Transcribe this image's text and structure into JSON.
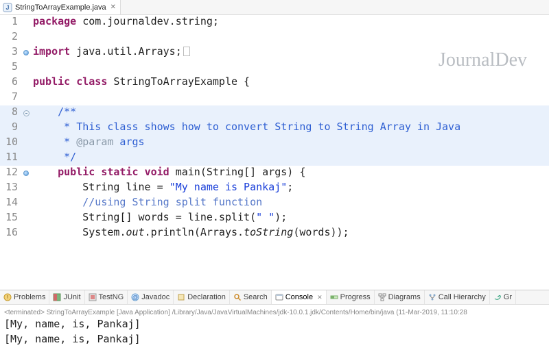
{
  "tab": {
    "file_name": "StringToArrayExample.java"
  },
  "watermark": "JournalDev",
  "code": {
    "lines": [
      {
        "n": 1,
        "segs": [
          {
            "c": "tok-key",
            "t": "package"
          },
          {
            "c": "",
            "t": " "
          },
          {
            "c": "tok-ident",
            "t": "com.journaldev.string"
          },
          {
            "c": "",
            "t": ";"
          }
        ]
      },
      {
        "n": 2,
        "segs": []
      },
      {
        "n": 3,
        "marker": "dot",
        "fold": true,
        "segs": [
          {
            "c": "tok-key",
            "t": "import"
          },
          {
            "c": "",
            "t": " "
          },
          {
            "c": "tok-ident",
            "t": "java.util.Arrays"
          },
          {
            "c": "",
            "t": ";"
          },
          {
            "c": "__box__",
            "t": ""
          }
        ]
      },
      {
        "n": 5,
        "segs": []
      },
      {
        "n": 6,
        "segs": [
          {
            "c": "tok-key",
            "t": "public"
          },
          {
            "c": "",
            "t": " "
          },
          {
            "c": "tok-key",
            "t": "class"
          },
          {
            "c": "",
            "t": " "
          },
          {
            "c": "tok-type",
            "t": "StringToArrayExample"
          },
          {
            "c": "",
            "t": " {"
          }
        ]
      },
      {
        "n": 7,
        "segs": []
      },
      {
        "n": 8,
        "hl": true,
        "fold": true,
        "segs": [
          {
            "c": "tok-doc",
            "t": "    /**"
          }
        ]
      },
      {
        "n": 9,
        "hl": true,
        "segs": [
          {
            "c": "tok-doc",
            "t": "     * This class shows how to convert String to String Array in Java"
          }
        ]
      },
      {
        "n": 10,
        "hl": true,
        "segs": [
          {
            "c": "tok-doc",
            "t": "     * "
          },
          {
            "c": "tok-doctag",
            "t": "@param"
          },
          {
            "c": "tok-doc",
            "t": " args"
          }
        ]
      },
      {
        "n": 11,
        "hl": true,
        "segs": [
          {
            "c": "tok-doc",
            "t": "     */"
          }
        ]
      },
      {
        "n": 12,
        "fold": true,
        "marker": "dot",
        "segs": [
          {
            "c": "",
            "t": "    "
          },
          {
            "c": "tok-key",
            "t": "public"
          },
          {
            "c": "",
            "t": " "
          },
          {
            "c": "tok-key",
            "t": "static"
          },
          {
            "c": "",
            "t": " "
          },
          {
            "c": "tok-key",
            "t": "void"
          },
          {
            "c": "",
            "t": " "
          },
          {
            "c": "tok-ident",
            "t": "main"
          },
          {
            "c": "",
            "t": "("
          },
          {
            "c": "tok-type",
            "t": "String"
          },
          {
            "c": "",
            "t": "[] "
          },
          {
            "c": "tok-ident",
            "t": "args"
          },
          {
            "c": "",
            "t": ") {"
          }
        ]
      },
      {
        "n": 13,
        "segs": [
          {
            "c": "",
            "t": "        "
          },
          {
            "c": "tok-type",
            "t": "String"
          },
          {
            "c": "",
            "t": " "
          },
          {
            "c": "tok-ident",
            "t": "line"
          },
          {
            "c": "",
            "t": " = "
          },
          {
            "c": "tok-str",
            "t": "\"My name is Pankaj\""
          },
          {
            "c": "",
            "t": ";"
          }
        ]
      },
      {
        "n": 14,
        "segs": [
          {
            "c": "",
            "t": "        "
          },
          {
            "c": "tok-comment",
            "t": "//using String split function"
          }
        ]
      },
      {
        "n": 15,
        "segs": [
          {
            "c": "",
            "t": "        "
          },
          {
            "c": "tok-type",
            "t": "String"
          },
          {
            "c": "",
            "t": "[] "
          },
          {
            "c": "tok-ident",
            "t": "words"
          },
          {
            "c": "",
            "t": " = "
          },
          {
            "c": "tok-ident",
            "t": "line"
          },
          {
            "c": "",
            "t": "."
          },
          {
            "c": "tok-ident",
            "t": "split"
          },
          {
            "c": "",
            "t": "("
          },
          {
            "c": "tok-str",
            "t": "\" \""
          },
          {
            "c": "",
            "t": ");"
          }
        ]
      },
      {
        "n": 16,
        "segs": [
          {
            "c": "",
            "t": "        "
          },
          {
            "c": "tok-type",
            "t": "System"
          },
          {
            "c": "",
            "t": "."
          },
          {
            "c": "tok-static",
            "t": "out"
          },
          {
            "c": "",
            "t": "."
          },
          {
            "c": "tok-ident",
            "t": "println"
          },
          {
            "c": "",
            "t": "("
          },
          {
            "c": "tok-type",
            "t": "Arrays"
          },
          {
            "c": "",
            "t": "."
          },
          {
            "c": "tok-func",
            "t": "toString"
          },
          {
            "c": "",
            "t": "("
          },
          {
            "c": "tok-ident",
            "t": "words"
          },
          {
            "c": "",
            "t": "));"
          }
        ]
      }
    ]
  },
  "panel_tabs": [
    {
      "id": "problems",
      "label": "Problems",
      "icon": "problems"
    },
    {
      "id": "junit",
      "label": "JUnit",
      "icon": "junit"
    },
    {
      "id": "testng",
      "label": "TestNG",
      "icon": "testng"
    },
    {
      "id": "javadoc",
      "label": "Javadoc",
      "icon": "javadoc"
    },
    {
      "id": "declaration",
      "label": "Declaration",
      "icon": "declaration"
    },
    {
      "id": "search",
      "label": "Search",
      "icon": "search"
    },
    {
      "id": "console",
      "label": "Console",
      "icon": "console",
      "active": true,
      "closable": true
    },
    {
      "id": "progress",
      "label": "Progress",
      "icon": "progress"
    },
    {
      "id": "diagrams",
      "label": "Diagrams",
      "icon": "diagrams"
    },
    {
      "id": "callhierarchy",
      "label": "Call Hierarchy",
      "icon": "callhierarchy"
    },
    {
      "id": "gradle",
      "label": "Gr",
      "icon": "gradle"
    }
  ],
  "console": {
    "terminated_line": "<terminated> StringToArrayExample [Java Application] /Library/Java/JavaVirtualMachines/jdk-10.0.1.jdk/Contents/Home/bin/java (11-Mar-2019, 11:10:28",
    "output": [
      "[My, name, is, Pankaj]",
      "[My, name, is, Pankaj]"
    ]
  }
}
